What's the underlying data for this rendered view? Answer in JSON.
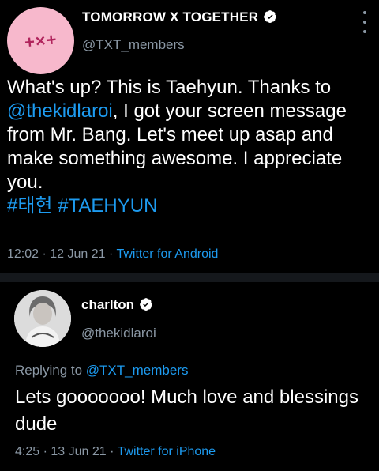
{
  "tweet1": {
    "avatar_text": "+×+",
    "name": "TOMORROW X TOGETHER",
    "handle": "@TXT_members",
    "body_parts": [
      "What's up? This is Taehyun. Thanks to ",
      "@thekidlaroi",
      ", I got your screen message from Mr. Bang. Let's meet up asap and make something awesome. I appreciate you."
    ],
    "hashtags": [
      "#태현",
      "#TAEHYUN"
    ],
    "time": "12:02 · 12 Jun 21 · ",
    "source": "Twitter for Android"
  },
  "tweet2": {
    "name": "charlton",
    "handle": "@thekidlaroi",
    "reply_prefix": "Replying to ",
    "reply_to": "@TXT_members",
    "body": "Lets gooooooo! Much love and blessings dude",
    "time": "4:25 · 13 Jun 21 · ",
    "source": "Twitter for iPhone"
  },
  "colors": {
    "link": "#1d9bf0",
    "muted": "#8b98a5",
    "background": "#000000"
  },
  "icons": [
    "txt-logo-icon",
    "verified-badge-icon",
    "more-options-icon",
    "profile-photo-icon"
  ]
}
